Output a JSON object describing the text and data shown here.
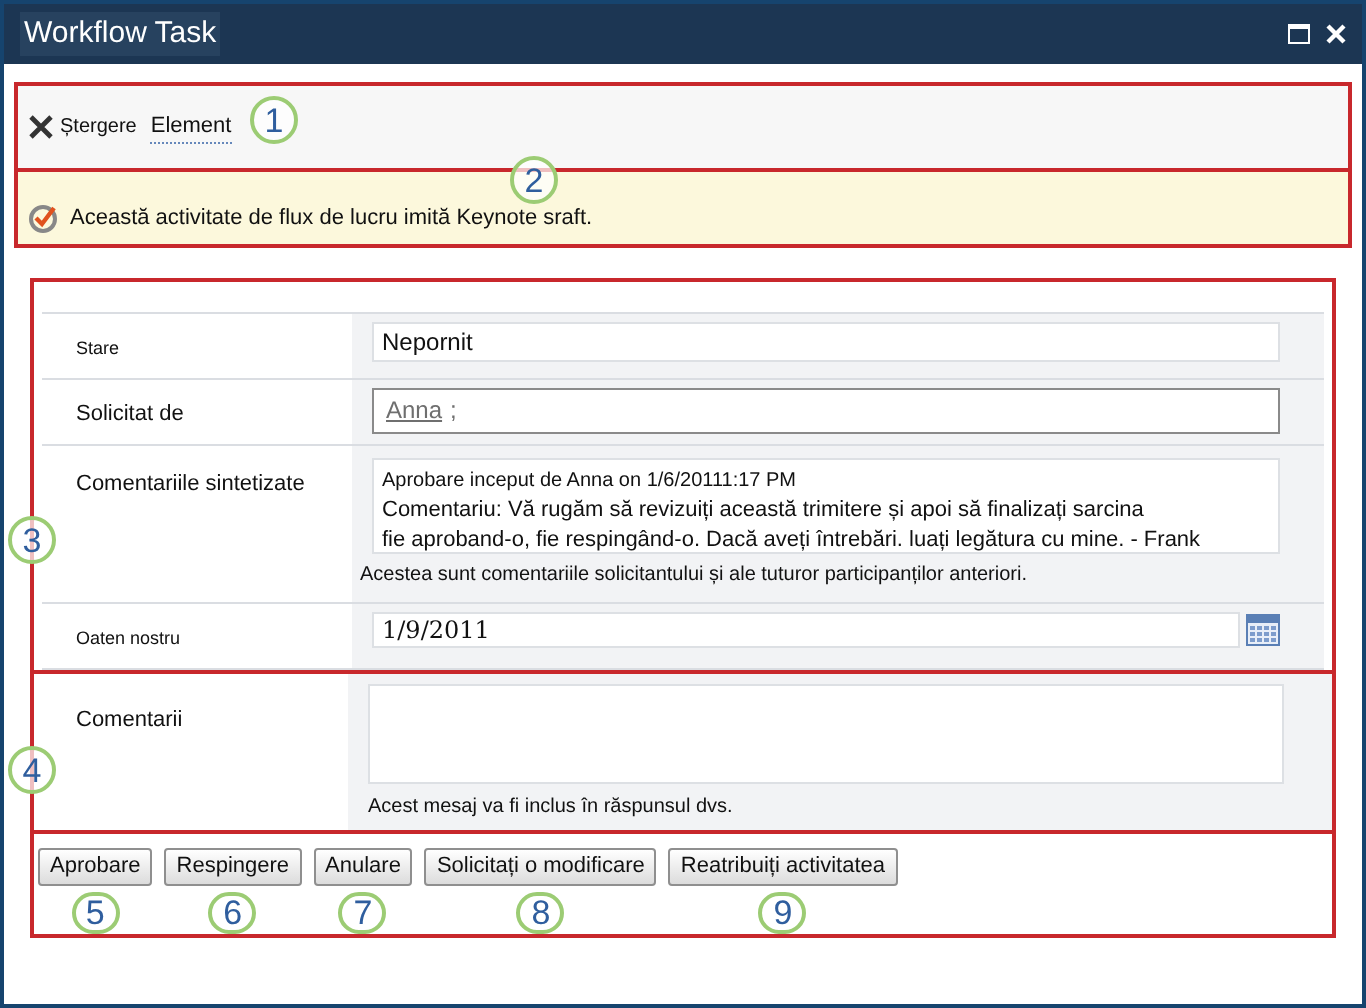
{
  "window": {
    "title": "Workflow Task"
  },
  "ribbon": {
    "delete_label": "Ștergere",
    "element_label": "Element",
    "callout": "1"
  },
  "notice": {
    "text": "Această activitate de flux de lucru imită Keynote sraft.",
    "callout": "2"
  },
  "form": {
    "callout": "3",
    "fields": [
      {
        "kind": "text",
        "label": "Stare",
        "value": "Nepornit"
      },
      {
        "kind": "people",
        "label": "Solicitat de",
        "value": "Anna",
        "separator": ";"
      },
      {
        "kind": "comments",
        "label": "Comentariile sintetizate",
        "lines": [
          "Aprobare inceput de Anna on 1/6/20111:17 PM",
          "Comentariu: Vă rugăm să revizuiți această trimitere și apoi să finalizați sarcina",
          "fie aproband-o, fie respingând-o. Dacă aveți întrebări. luați legătura cu mine. - Frank"
        ],
        "hint": "Acestea sunt comentariile solicitantului și ale tuturor participanților anteriori."
      },
      {
        "kind": "date",
        "label": "Oaten nostru",
        "value": "1/9/2011"
      }
    ]
  },
  "comments": {
    "label": "Comentarii",
    "hint": "Acest mesaj va fi inclus în răspunsul dvs.",
    "callout": "4"
  },
  "buttons": [
    {
      "label": "Aprobare",
      "callout": "5"
    },
    {
      "label": "Respingere",
      "callout": "6"
    },
    {
      "label": "Anulare",
      "callout": "7"
    },
    {
      "label": "Solicitați o modificare",
      "callout": "8"
    },
    {
      "label": "Reatribuiți activitatea",
      "callout": "9"
    }
  ]
}
